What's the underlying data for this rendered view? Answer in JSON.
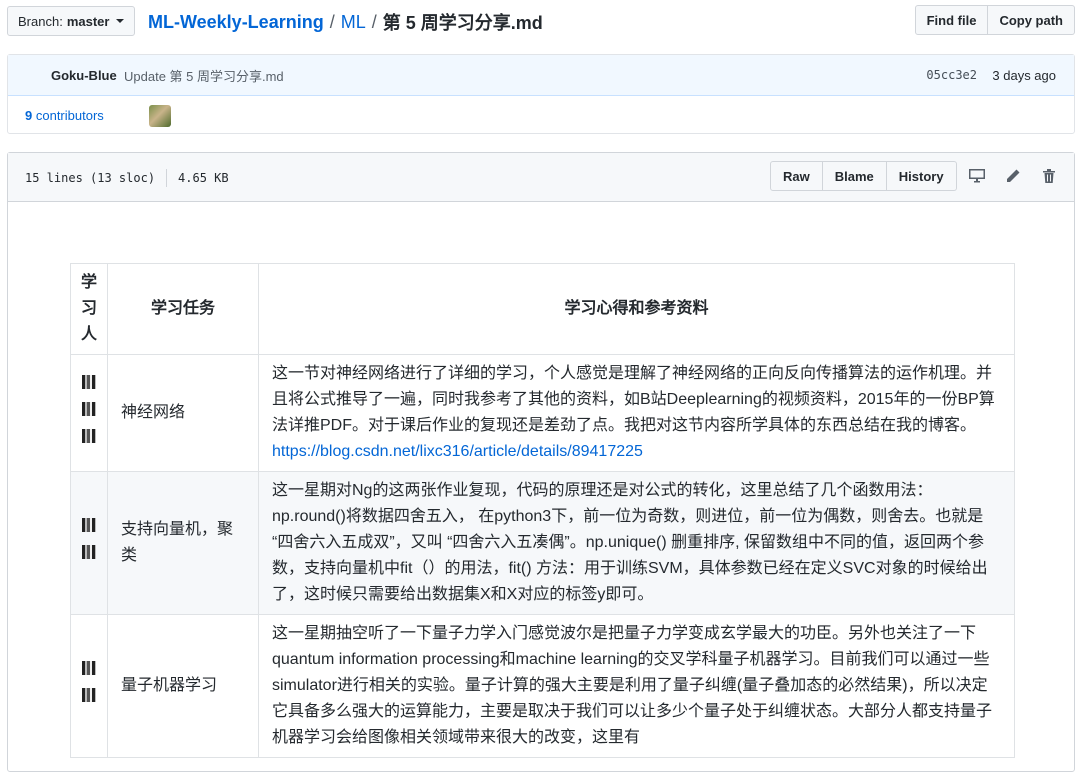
{
  "topbar": {
    "branch_prefix": "Branch:",
    "branch_name": "master",
    "repo": "ML-Weekly-Learning",
    "sep1": "/",
    "dir": "ML",
    "sep2": "/",
    "file": "第 5 周学习分享.md",
    "find_file": "Find file",
    "copy_path": "Copy path"
  },
  "commit": {
    "author": "Goku-Blue",
    "message": "Update 第 5 周学习分享.md",
    "sha": "05cc3e2",
    "time": "3 days ago",
    "contributors_count": "9",
    "contributors_label": "contributors"
  },
  "file": {
    "lines": "15 lines (13 sloc)",
    "size": "4.65 KB",
    "raw": "Raw",
    "blame": "Blame",
    "history": "History",
    "icons": [
      "desktop-icon",
      "pencil-icon",
      "trash-icon"
    ]
  },
  "table": {
    "headers": [
      "学\n习\n人",
      "学习任务",
      "学习心得和参考资料"
    ],
    "rows": [
      {
        "task": "神经网络",
        "notes": "这一节对神经网络进行了详细的学习，个人感觉是理解了神经网络的正向反向传播算法的运作机理。并且将公式推导了一遍，同时我参考了其他的资料，如B站Deeplearning的视频资料，2015年的一份BP算法详推PDF。对于课后作业的复现还是差劲了点。我把对这节内容所学具体的东西总结在我的博客。",
        "link": "https://blog.csdn.net/lixc316/article/details/89417225"
      },
      {
        "task": "支持向量机，聚类",
        "notes": "这一星期对Ng的这两张作业复现，代码的原理还是对公式的转化，这里总结了几个函数用法：np.round()将数据四舍五入， 在python3下，前一位为奇数，则进位，前一位为偶数，则舍去。也就是 “四舍六入五成双”，又叫 “四舍六入五凑偶”。np.unique() 删重排序, 保留数组中不同的值，返回两个参数，支持向量机中fit（）的用法，fit() 方法：用于训练SVM，具体参数已经在定义SVC对象的时候给出了，这时候只需要给出数据集X和X对应的标签y即可。"
      },
      {
        "task": "量子机器学习",
        "notes": "这一星期抽空听了一下量子力学入门感觉波尔是把量子力学变成玄学最大的功臣。另外也关注了一下quantum information processing和machine learning的交叉学科量子机器学习。目前我们可以通过一些simulator进行相关的实验。量子计算的强大主要是利用了量子纠缠(量子叠加态的必然结果)，所以决定它具备多么强大的运算能力，主要是取决于我们可以让多少个量子处于纠缠状态。大部分人都支持量子机器学习会给图像相关领域带来很大的改变，这里有"
      }
    ]
  }
}
